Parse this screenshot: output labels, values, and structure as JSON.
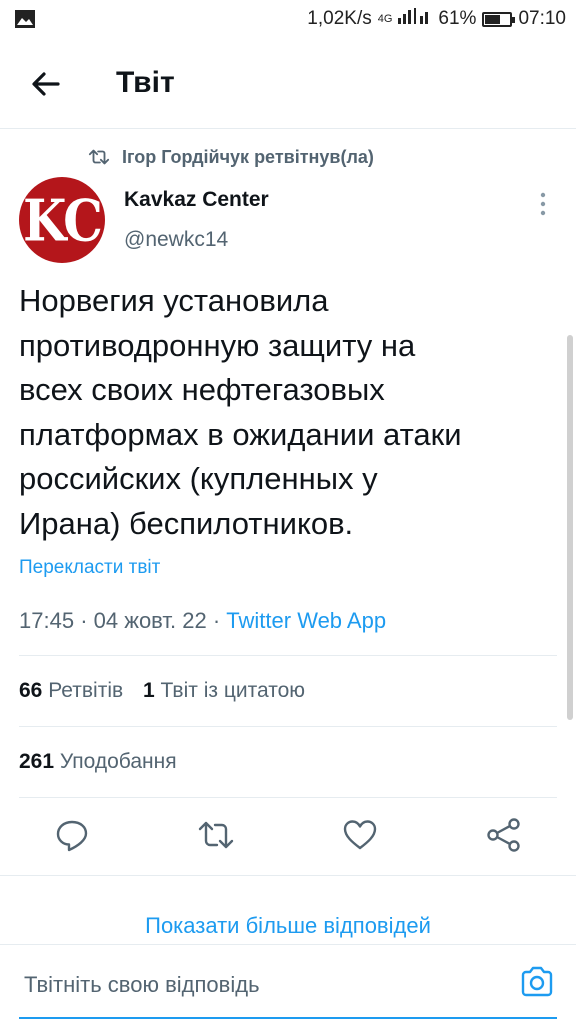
{
  "status_bar": {
    "speed": "1,02K/s",
    "network": "4G",
    "battery_percent": "61%",
    "battery_level": 0.61,
    "time": "07:10"
  },
  "header": {
    "title": "Твіт"
  },
  "retweet_context": {
    "text": "Ігор Гордійчук ретвітнув(ла)"
  },
  "author": {
    "avatar_text": "KC",
    "name": "Kavkaz Center",
    "handle": "@newkc14"
  },
  "tweet": {
    "lines": [
      "Норвегия установила",
      "противодронную защиту на",
      "всех своих нефтегазовых",
      "платформах в ожидании атаки",
      "российских (купленных у",
      "Ирана) беспилотников."
    ],
    "translate_label": "Перекласти твіт",
    "time": "17:45",
    "separator": "·",
    "date": "04 жовт. 22",
    "source": "Twitter Web App"
  },
  "stats": {
    "retweets_count": "66",
    "retweets_label": "Ретвітів",
    "quotes_count": "1",
    "quotes_label": "Твіт із цитатою",
    "likes_count": "261",
    "likes_label": "Уподобання"
  },
  "actions": {
    "icons": [
      "reply-icon",
      "retweet-icon",
      "like-icon",
      "share-icon"
    ]
  },
  "show_more_replies": "Показати більше відповідей",
  "reply_bar": {
    "placeholder": "Твітніть свою відповідь"
  },
  "colors": {
    "accent": "#1d9bf0",
    "text": "#0f1419",
    "secondary": "#536471",
    "avatar_bg": "#b4161b"
  }
}
